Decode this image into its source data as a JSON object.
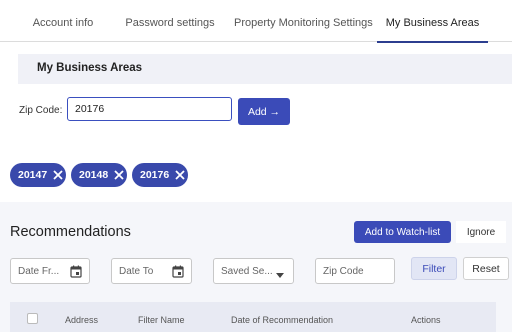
{
  "tabs": [
    {
      "label": "Account info"
    },
    {
      "label": "Password settings"
    },
    {
      "label": "Property Monitoring Settings"
    },
    {
      "label": "My Business Areas"
    }
  ],
  "section": {
    "title": "My Business Areas"
  },
  "zip": {
    "label": "Zip Code:",
    "value": "20176",
    "add_label": "Add →"
  },
  "chips": [
    {
      "label": "20147"
    },
    {
      "label": "20148"
    },
    {
      "label": "20176"
    }
  ],
  "recommendations": {
    "title": "Recommendations",
    "watchlist_label": "Add to Watch-list",
    "ignore_label": "Ignore",
    "filters": {
      "date_from": "Date Fr...",
      "date_to": "Date To",
      "saved_search": "Saved Se...",
      "zip_placeholder": "Zip Code",
      "filter_label": "Filter",
      "reset_label": "Reset"
    },
    "columns": [
      "Address",
      "Filter Name",
      "Date of Recommendation",
      "Actions"
    ]
  },
  "colors": {
    "accent": "#3b4bb8",
    "chip": "#3949ab",
    "panel": "#f5f6fa"
  }
}
